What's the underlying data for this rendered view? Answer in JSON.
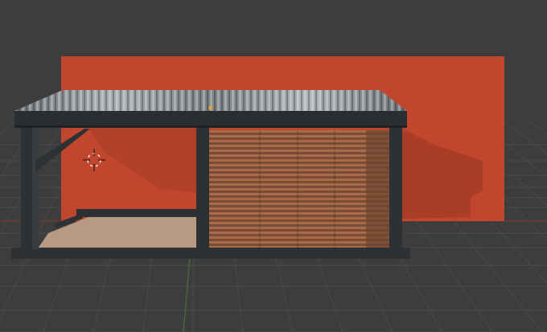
{
  "viewport": {
    "background": "#3d3d3d",
    "grid_color": "#4a4a4a",
    "x_axis_color": "#8a3a3a",
    "y_axis_color": "#5a7a3a"
  },
  "scene": {
    "backdrop_color": "#c0472d",
    "shadow_color": "#9a3a24",
    "roof_color": "#8c9296",
    "frame_color": "#2e3133",
    "floor_color": "#b89a84",
    "louver_color": "#8a5a40"
  },
  "icons": {
    "cursor": "3d-cursor-icon",
    "origin": "origin-point-icon"
  }
}
